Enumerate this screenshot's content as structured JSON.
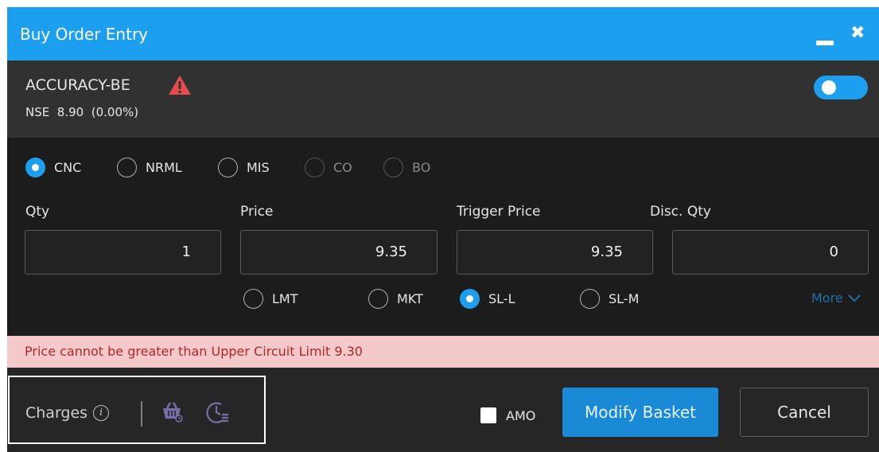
{
  "window": {
    "title": "Buy Order Entry"
  },
  "symbol": {
    "name": "ACCURACY-BE",
    "exchange": "NSE",
    "ltp": "8.90",
    "change": "(0.00%)"
  },
  "product_types": [
    {
      "label": "CNC",
      "selected": true,
      "enabled": true
    },
    {
      "label": "NRML",
      "selected": false,
      "enabled": true
    },
    {
      "label": "MIS",
      "selected": false,
      "enabled": true
    },
    {
      "label": "CO",
      "selected": false,
      "enabled": false
    },
    {
      "label": "BO",
      "selected": false,
      "enabled": false
    }
  ],
  "fields": {
    "qty": {
      "label": "Qty",
      "value": "1"
    },
    "price": {
      "label": "Price",
      "value": "9.35"
    },
    "trigger": {
      "label": "Trigger Price",
      "value": "9.35"
    },
    "disc_qty": {
      "label": "Disc. Qty",
      "value": "0"
    }
  },
  "order_types": [
    {
      "label": "LMT",
      "selected": false
    },
    {
      "label": "MKT",
      "selected": false
    },
    {
      "label": "SL-L",
      "selected": true
    },
    {
      "label": "SL-M",
      "selected": false
    }
  ],
  "more_label": "More",
  "error_message": "Price cannot be greater than Upper Circuit Limit 9.30",
  "footer": {
    "charges_label": "Charges",
    "amo_label": "AMO",
    "modify_label": "Modify Basket",
    "cancel_label": "Cancel"
  },
  "colors": {
    "accent": "#1d9ff0",
    "error_bg": "#f3c9c9",
    "error_text": "#b5262a",
    "warning": "#e74c4c"
  },
  "icons": [
    "minimize-icon",
    "close-icon",
    "warning-icon",
    "info-icon",
    "basket-icon",
    "clock-list-icon",
    "chevron-down-icon"
  ]
}
